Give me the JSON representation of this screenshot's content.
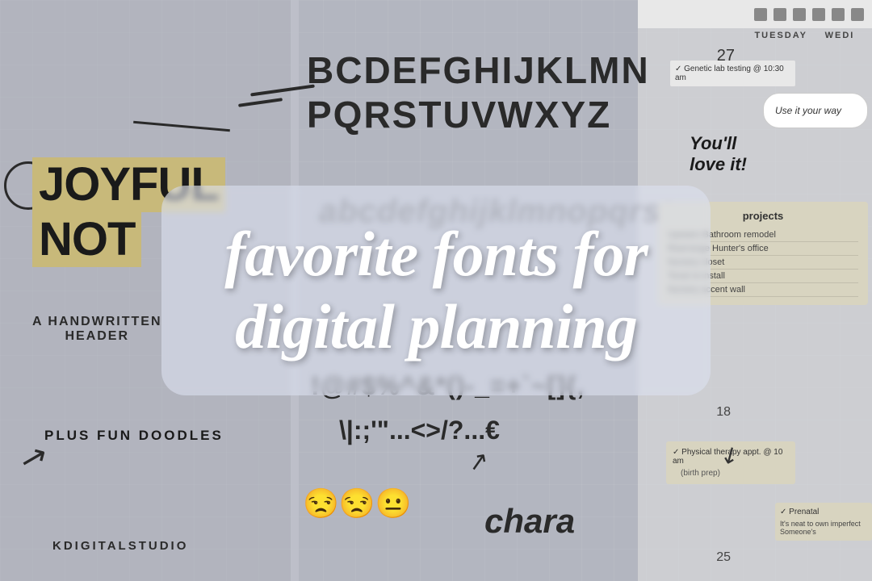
{
  "background": {
    "color": "#8a8f9a"
  },
  "left_panel": {
    "title_line1": "JOYFUL",
    "title_line2": "NOT",
    "subtitle": "A HANDWRITTEN",
    "subtitle2": "HEADER",
    "doodles": "PLUS FUN DOODLES",
    "brand": "KDIGITALSTUDIO"
  },
  "middle_panel": {
    "alphabet_upper1": "BCDEFGHIJKLMN",
    "alphabet_upper2": "PQRSTUVWXYZ",
    "alphabet_lower": "abcdefghijk...",
    "special_chars1": "!@#$%^&*()-_=+`~[]{,",
    "special_chars2": "\\|:;'\"...<>/?...€",
    "charo": "chara",
    "emojis": "😒😒😐"
  },
  "right_panel": {
    "column1": "TUESDAY",
    "column2": "WEDI",
    "day_num": "27",
    "speech_bubble": "Use it your way",
    "love_text_line1": "You'll",
    "love_text_line2": "love it!",
    "projects_title": "projects",
    "projects": [
      "Upstairs Bathroom remodel",
      "Rearrange Hunter's office",
      "Nursery closet",
      "Tonal re-install",
      "Nursery accent wall"
    ],
    "row2_num": "18",
    "physical_check": "✓ Physical therapy appt. @ 10 am",
    "physical_sub": "(birth prep)",
    "prenatal_check": "✓ Prenatal",
    "neat_text": "It's neat to own imperfect Someone's",
    "row3_num": "25"
  },
  "main_title": {
    "line1": "favorite fonts for",
    "line2": "digital planning"
  }
}
